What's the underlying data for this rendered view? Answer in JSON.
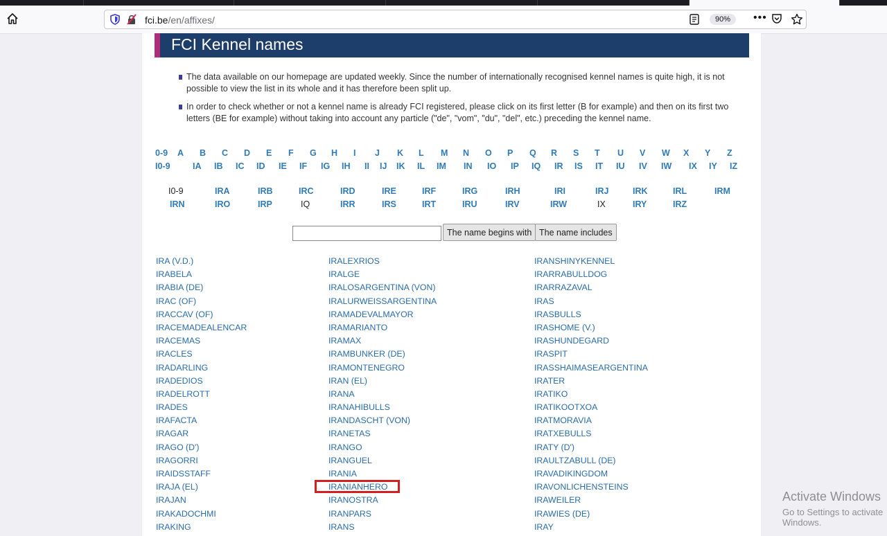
{
  "browser": {
    "url_domain": "fci.be",
    "url_path": "/en/affixes/",
    "zoom": "90%"
  },
  "page": {
    "title": "FCI Kennel names",
    "info": [
      "The data available on our homepage are updated weekly. Since the number of internationally recognised kennel names is quite high, it is not possible to view the list in its whole and it has therefore been split up.",
      "In order to check whether or not a kennel name is already FCI registered, please click on its first letter (B for example) and then on its first two letters (BE for example) without taking into account any particle (\"de\", \"vom\", \"du\", \"del\", etc.) preceding the kennel name."
    ],
    "letters_row1": [
      "0-9",
      "A",
      "B",
      "C",
      "D",
      "E",
      "F",
      "G",
      "H",
      "I",
      "J",
      "K",
      "L",
      "M",
      "N",
      "O",
      "P",
      "Q",
      "R",
      "S",
      "T",
      "U",
      "V",
      "W",
      "X",
      "Y",
      "Z"
    ],
    "letters_row2": [
      "I0-9",
      "IA",
      "IB",
      "IC",
      "ID",
      "IE",
      "IF",
      "IG",
      "IH",
      "II",
      "IJ",
      "IK",
      "IL",
      "IM",
      "IN",
      "IO",
      "IP",
      "IQ",
      "IR",
      "IS",
      "IT",
      "IU",
      "IV",
      "IW",
      "IX",
      "IY",
      "IZ"
    ],
    "sub_row1": [
      "I0-9",
      "IRA",
      "IRB",
      "IRC",
      "IRD",
      "IRE",
      "IRF",
      "IRG",
      "IRH",
      "IRI",
      "IRJ",
      "IRK",
      "IRL",
      "IRM"
    ],
    "sub_row2": [
      "IRN",
      "IRO",
      "IRP",
      "IQ",
      "IRR",
      "IRS",
      "IRT",
      "IRU",
      "IRV",
      "IRW",
      "IX",
      "IRY",
      "IRZ"
    ],
    "search_value": "",
    "btn_begins": "The name begins with",
    "btn_includes": "The name includes",
    "names_col1": [
      "IRA (V.D.)",
      "IRABELA",
      "IRABIA (DE)",
      "IRAC (OF)",
      "IRACCAV (OF)",
      "IRACEMADEALENCAR",
      "IRACEMAS",
      "IRACLES",
      "IRADARLING",
      "IRADEDIOS",
      "IRADELROTT",
      "IRADES",
      "IRAFACTA",
      "IRAGAR",
      "IRAGO (D')",
      "IRAGORRI",
      "IRAIDSSTAFF",
      "IRAJA (EL)",
      "IRAJAN",
      "IRAKADOCHMI",
      "IRAKING"
    ],
    "names_col2": [
      "IRALEXRIOS",
      "IRALGE",
      "IRALOSARGENTINA (VON)",
      "IRALURWEISSARGENTINA",
      "IRAMADEVALMAYOR",
      "IRAMARIANTO",
      "IRAMAX",
      "IRAMBUNKER (DE)",
      "IRAMONTENEGRO",
      "IRAN (EL)",
      "IRANA",
      "IRANAHIBULLS",
      "IRANDASCHT (VON)",
      "IRANETAS",
      "IRANGO",
      "IRANGUEL",
      "IRANIA",
      "IRANIANHERO",
      "IRANOSTRA",
      "IRANPARS",
      "IRANS"
    ],
    "names_col3": [
      "IRANSHINYKENNEL",
      "IRARRABULLDOG",
      "IRARRAZAVAL",
      "IRAS",
      "IRASBULLS",
      "IRASHOME (V.)",
      "IRASHUNDEGARD",
      "IRASPIT",
      "IRASSHAIMASEARGENTINA",
      "IRATER",
      "IRATIKO",
      "IRATIKOOTXOA",
      "IRATMORAVIA",
      "IRATXEBULLS",
      "IRATY (D')",
      "IRAULTZABULL (DE)",
      "IRAVADIKINGDOM",
      "IRAVONLICHENSTEINS",
      "IRAWEILER",
      "IRAWIES (DE)",
      "IRAY"
    ]
  },
  "watermark": {
    "line1": "Activate Windows",
    "line2": "Go to Settings to activate Windows."
  }
}
